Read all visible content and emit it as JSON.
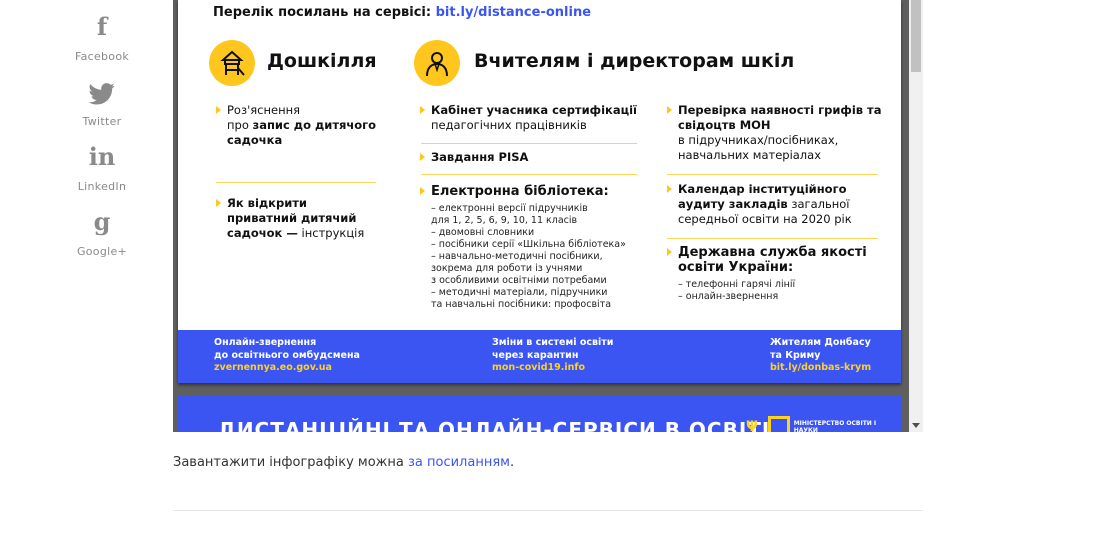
{
  "share": [
    {
      "label": "Facebook",
      "icon": "facebook-icon",
      "glyph": "f"
    },
    {
      "label": "Twitter",
      "icon": "twitter-icon"
    },
    {
      "label": "LinkedIn",
      "icon": "linkedin-icon",
      "glyph": "in"
    },
    {
      "label": "Google+",
      "icon": "google-plus-icon",
      "glyph": "g"
    }
  ],
  "doc": {
    "links_heading": "Перелік посилань на сервісі:",
    "links_url": "bit.ly/distance-online",
    "preschool": {
      "title": "Дошкілля",
      "item1": {
        "pre": "Роз'яснення",
        "mid": "про ",
        "bold": "запис до дитячого садочка"
      },
      "item2": {
        "bold": "Як відкрити приватний дитячий садочок —",
        "rest": " інструкція"
      }
    },
    "teachers": {
      "title": "Вчителям і директорам шкіл",
      "item1": {
        "bold": "Кабінет учасника сертифікації",
        "rest": "педагогічних працівників"
      },
      "item2": {
        "bold": "Завдання PISA"
      },
      "item3": {
        "bold": "Електронна бібліотека:",
        "lines": [
          "– електронні версії підручників",
          "для 1, 2, 5, 6, 9, 10, 11 класів",
          "– двомовні словники",
          "– посібники серії «Шкільна бібліотека»",
          "– навчально-методичні посібники,",
          "зокрема для роботи із учнями",
          "з особливими освітніми потребами",
          "– методичні матеріали, підручники",
          "та навчальні посібники: профосвіта"
        ]
      },
      "item4": {
        "bold": "Перевірка наявності грифів та свідоцтв МОН",
        "rest": "в підручниках/посібниках, навчальних матеріалах"
      },
      "item5": {
        "bold": "Календар інституційного аудиту закладів",
        "rest": " загальної середньої освіти на 2020 рік"
      },
      "item6": {
        "bold": "Державна служба якості освіти України:",
        "lines": [
          "– телефонні гарячі лінії",
          "– онлайн-звернення"
        ]
      }
    },
    "footer": [
      {
        "line1": "Онлайн-звернення",
        "line2": "до освітнього омбудсмена",
        "link": "zvernennya.eo.gov.ua"
      },
      {
        "line1": "Зміни в системі освіти",
        "line2": "через карантин",
        "link": "mon-covid19.info"
      },
      {
        "line1": "Жителям Донбасу",
        "line2": "та Криму",
        "link": "bit.ly/donbas-krym"
      }
    ],
    "page2": {
      "title": "ДИСТАНЦІЙНІ ТА ОНЛАЙН-СЕРВІСИ В ОСВІТІ",
      "ministry": "МІНІСТЕРСТВО ОСВІТИ І НАУКИ"
    }
  },
  "download": {
    "text": "Завантажити інфографіку можна ",
    "link": "за посиланням",
    "tail": "."
  },
  "colors": {
    "accent_blue": "#3b55f3",
    "accent_yellow": "#ffc71e"
  }
}
